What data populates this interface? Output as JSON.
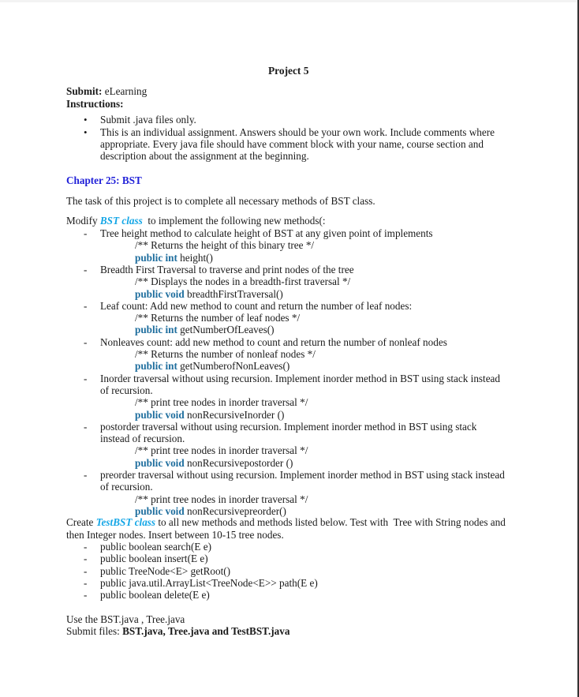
{
  "document": {
    "title": "Project 5",
    "submit_label": "Submit:",
    "submit_value": "eLearning",
    "instructions_label": "Instructions:",
    "instructions": [
      "Submit .java files only.",
      [
        "This is an individual assignment. Answers should be your own work. Include comments where",
        "appropriate. Every java file should have comment block with your name, course section and",
        "description about the assignment at the beginning."
      ]
    ],
    "chapter_heading": "Chapter 25: BST",
    "task_intro": "The task of this project is to complete all necessary methods of BST class.",
    "modify": {
      "prefix": "Modify ",
      "class_name": "BST class",
      "suffix": "  to implement the following new methods(:"
    },
    "methods": [
      {
        "desc": [
          "Tree height method to calculate height of BST at any given point of implements"
        ],
        "comment": "/** Returns the height of this binary tree */",
        "keyword": "public int",
        "signature": " height()"
      },
      {
        "desc": [
          "Breadth First Traversal to traverse and print nodes of the tree"
        ],
        "comment": "/** Displays the nodes in a breadth-first traversal */",
        "keyword": "public void",
        "signature": " breadthFirstTraversal()"
      },
      {
        "desc": [
          "Leaf count: Add new method to count and return the number of leaf nodes:"
        ],
        "comment": "/** Returns the number of leaf nodes */",
        "keyword": "public int",
        "signature": " getNumberOfLeaves()"
      },
      {
        "desc": [
          "Nonleaves count: add new method to count and return the number of nonleaf nodes"
        ],
        "comment": "/** Returns the number of nonleaf nodes */",
        "keyword": "public int",
        "signature": " getNumberofNonLeaves()"
      },
      {
        "desc": [
          "Inorder traversal without using recursion. Implement inorder method in BST using stack instead",
          "of recursion."
        ],
        "comment": "/** print tree nodes in inorder traversal */",
        "keyword": "public void",
        "signature": " nonRecursiveInorder ()"
      },
      {
        "desc": [
          "postorder traversal without using recursion. Implement inorder method in BST using stack",
          "instead of recursion."
        ],
        "comment": "/** print tree nodes in inorder traversal */",
        "keyword": "public void",
        "signature": " nonRecursivepostorder ()"
      },
      {
        "desc": [
          "preorder traversal without using recursion. Implement inorder method in BST using stack instead",
          "of recursion."
        ],
        "comment": "/** print tree nodes in inorder traversal */",
        "keyword": "public void",
        "signature": " nonRecursivepreorder()"
      }
    ],
    "create": {
      "prefix": "Create ",
      "class_name": "TestBST class",
      "suffix": " to all new methods and methods listed below. Test with  Tree with String nodes and",
      "line2": "then Integer nodes. Insert between 10-15 tree nodes."
    },
    "test_methods": [
      "public boolean search(E e)",
      "public boolean insert(E e)",
      "public TreeNode<E> getRoot()",
      "public java.util.ArrayList<TreeNode<E>> path(E e)",
      "public boolean delete(E e)"
    ],
    "use_line": "Use the BST.java , Tree.java",
    "submit_files_label": "Submit files: ",
    "submit_files_value": "BST.java, Tree.java and TestBST.java",
    "bullet_glyph": "•",
    "dash_glyph": "-",
    "colors": {
      "chapter": "#1f1fd8",
      "class_name": "#14a6e6",
      "keyword": "#1f6e9e",
      "text": "#1a1a1a"
    }
  }
}
